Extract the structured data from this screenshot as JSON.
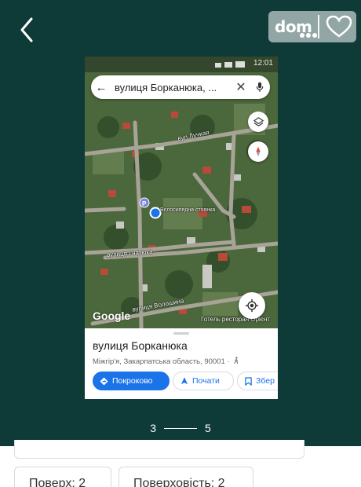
{
  "watermark": {
    "text": "dom"
  },
  "map": {
    "search_text": "вулиця Борканюка, ...",
    "google_logo": "Google",
    "marker_label": "Вєлосипедна стоянка",
    "street_labels": [
      "вул Лучкая",
      "вулиця Гнатюка",
      "вулиця Волошина"
    ],
    "poi_label": "Готель ресторан Орієнт",
    "status_time": "12:01"
  },
  "place": {
    "title": "вулиця Борканюка",
    "address": "Міжгір'я, Закарпатська область, 90001 ·"
  },
  "actions": {
    "directions": "Покроково",
    "start": "Почати",
    "save": "Збер"
  },
  "pager": {
    "current": "3",
    "total": "5"
  },
  "details": {
    "floor": "Поверх: 2",
    "floors_total": "Поверховість: 2"
  },
  "colors": {
    "viewer_bg": "#0e3b38",
    "accent": "#1a73e8"
  }
}
